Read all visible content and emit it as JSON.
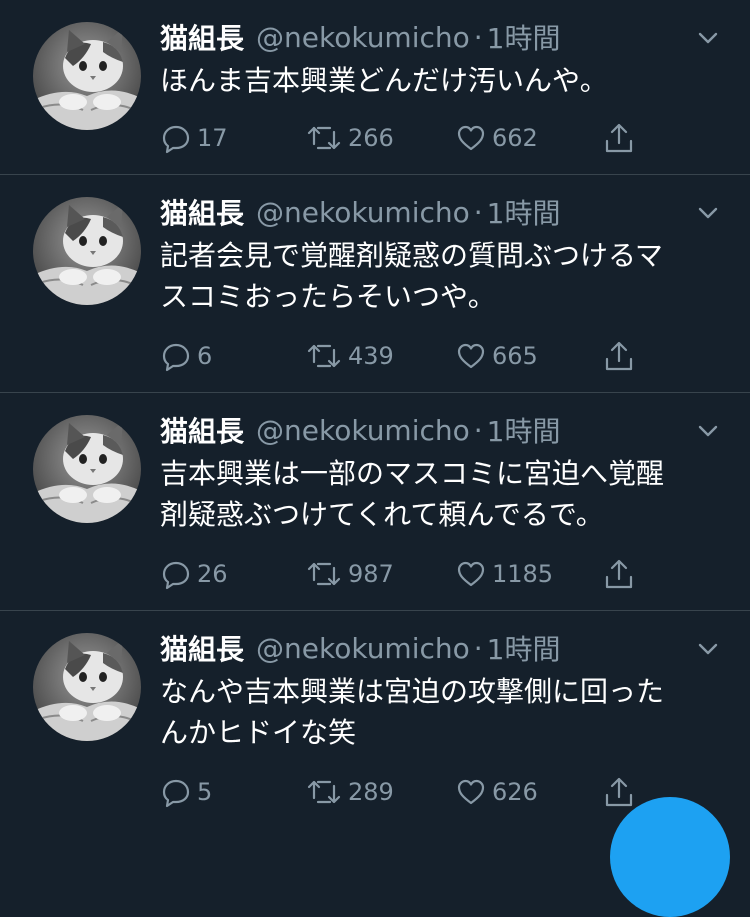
{
  "colors": {
    "background": "#15202b",
    "primary_text": "#ffffff",
    "secondary_text": "#8899a6",
    "divider": "#38444d",
    "accent": "#1da1f2"
  },
  "icons": {
    "reply": "reply-icon",
    "retweet": "retweet-icon",
    "like": "heart-icon",
    "share": "share-icon",
    "menu": "chevron-down-icon"
  },
  "tweets": [
    {
      "name": "猫組長",
      "handle": "@nekokumicho",
      "dot": "·",
      "time": "1時間",
      "text": "ほんま吉本興業どんだけ汚いんや。",
      "replies": "17",
      "retweets": "266",
      "likes": "662"
    },
    {
      "name": "猫組長",
      "handle": "@nekokumicho",
      "dot": "·",
      "time": "1時間",
      "text": "記者会見で覚醒剤疑惑の質問ぶつけるマ\nスコミおったらそいつや。",
      "replies": "6",
      "retweets": "439",
      "likes": "665"
    },
    {
      "name": "猫組長",
      "handle": "@nekokumicho",
      "dot": "·",
      "time": "1時間",
      "text": "吉本興業は一部のマスコミに宮迫へ覚醒\n剤疑惑ぶつけてくれて頼んでるで。",
      "replies": "26",
      "retweets": "987",
      "likes": "1185"
    },
    {
      "name": "猫組長",
      "handle": "@nekokumicho",
      "dot": "·",
      "time": "1時間",
      "text": "なんや吉本興業は宮迫の攻撃側に回った\nんかヒドイな笑",
      "replies": "5",
      "retweets": "289",
      "likes": "626"
    }
  ]
}
